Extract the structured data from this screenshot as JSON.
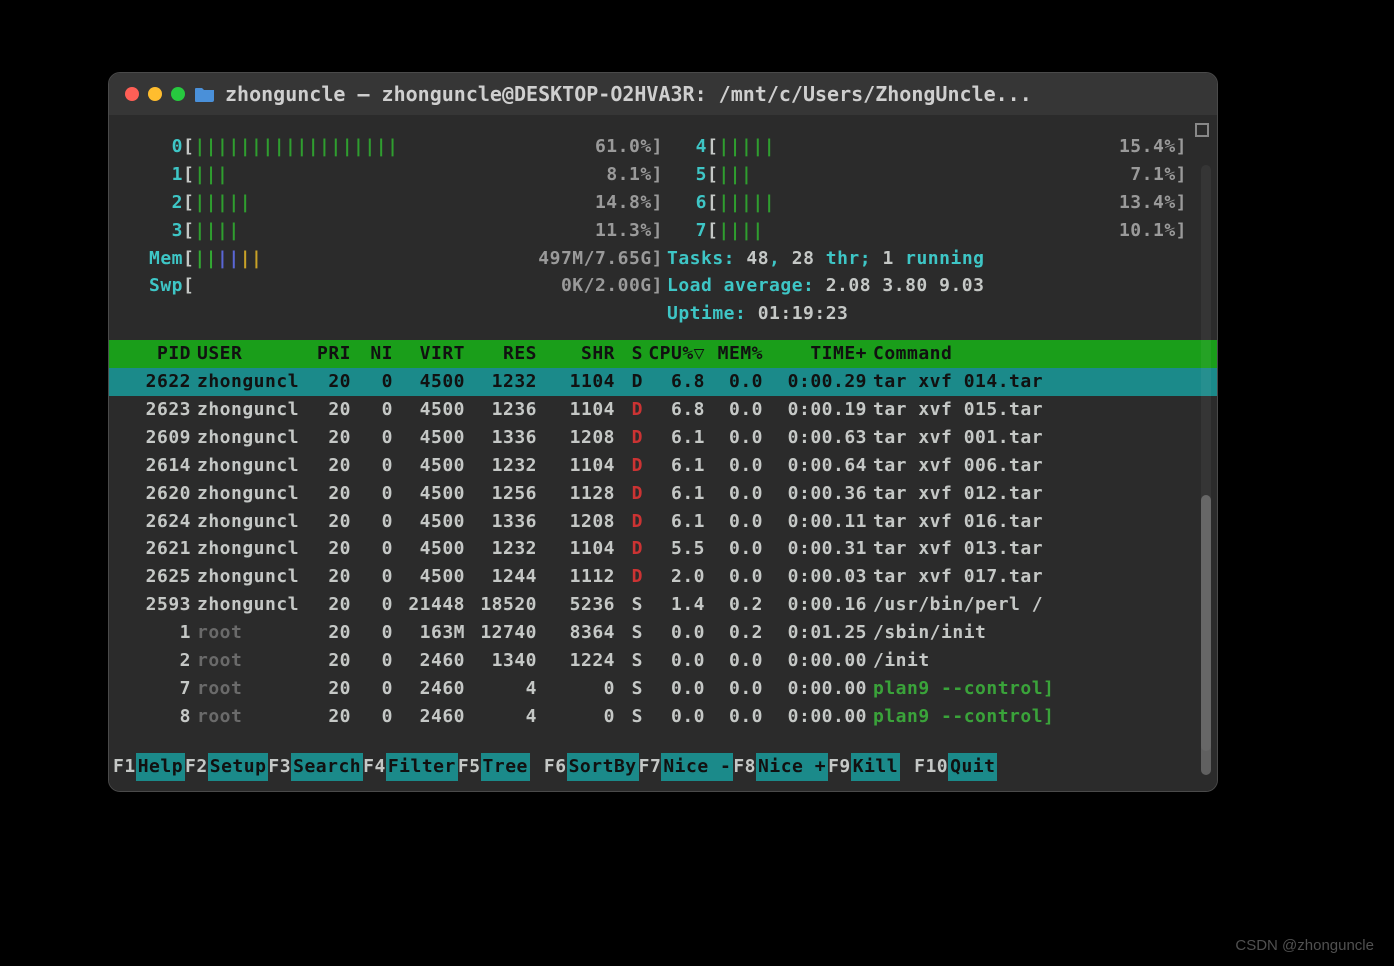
{
  "window": {
    "title": "zhonguncle — zhonguncle@DESKTOP-O2HVA3R: /mnt/c/Users/ZhongUncle..."
  },
  "cpu_meters": [
    {
      "id": "0",
      "bar": "||||||||||||||||||",
      "pct": "61.0%"
    },
    {
      "id": "1",
      "bar": "|||",
      "pct": "8.1%"
    },
    {
      "id": "2",
      "bar": "|||||",
      "pct": "14.8%"
    },
    {
      "id": "3",
      "bar": "||||",
      "pct": "11.3%"
    },
    {
      "id": "4",
      "bar": "|||||",
      "pct": "15.4%"
    },
    {
      "id": "5",
      "bar": "|||",
      "pct": "7.1%"
    },
    {
      "id": "6",
      "bar": "|||||",
      "pct": "13.4%"
    },
    {
      "id": "7",
      "bar": "||||",
      "pct": "10.1%"
    }
  ],
  "mem": {
    "label": "Mem",
    "bar_g": "||",
    "bar_b": "||",
    "bar_y": "||",
    "text": "497M/7.65G"
  },
  "swp": {
    "label": "Swp",
    "bar": "",
    "text": "0K/2.00G"
  },
  "stats": {
    "tasks_label": "Tasks: ",
    "tasks": "48",
    "thr_sep": ", ",
    "thr": "28",
    "thr_label": " thr; ",
    "running": "1",
    "running_label": " running",
    "load_label": "Load average: ",
    "l1": "2.08",
    "l2": "3.80",
    "l3": "9.03",
    "uptime_label": "Uptime: ",
    "uptime": "01:19:23"
  },
  "columns": {
    "pid": "PID",
    "user": "USER",
    "pri": "PRI",
    "ni": "NI",
    "virt": "VIRT",
    "res": "RES",
    "shr": "SHR",
    "s": "S",
    "cpu": "CPU%▽",
    "mem": "MEM%",
    "time": "TIME+",
    "cmd": "Command"
  },
  "processes": [
    {
      "pid": "2622",
      "user": "zhonguncl",
      "pri": "20",
      "ni": "0",
      "virt": "4500",
      "res": "1232",
      "shr": "1104",
      "s": "D",
      "cpu": "6.8",
      "mem": "0.0",
      "time": "0:00.29",
      "cmd": "tar xvf 014.tar",
      "sel": true
    },
    {
      "pid": "2623",
      "user": "zhonguncl",
      "pri": "20",
      "ni": "0",
      "virt": "4500",
      "res": "1236",
      "shr": "1104",
      "s": "D",
      "cpu": "6.8",
      "mem": "0.0",
      "time": "0:00.19",
      "cmd": "tar xvf 015.tar"
    },
    {
      "pid": "2609",
      "user": "zhonguncl",
      "pri": "20",
      "ni": "0",
      "virt": "4500",
      "res": "1336",
      "shr": "1208",
      "s": "D",
      "cpu": "6.1",
      "mem": "0.0",
      "time": "0:00.63",
      "cmd": "tar xvf 001.tar"
    },
    {
      "pid": "2614",
      "user": "zhonguncl",
      "pri": "20",
      "ni": "0",
      "virt": "4500",
      "res": "1232",
      "shr": "1104",
      "s": "D",
      "cpu": "6.1",
      "mem": "0.0",
      "time": "0:00.64",
      "cmd": "tar xvf 006.tar"
    },
    {
      "pid": "2620",
      "user": "zhonguncl",
      "pri": "20",
      "ni": "0",
      "virt": "4500",
      "res": "1256",
      "shr": "1128",
      "s": "D",
      "cpu": "6.1",
      "mem": "0.0",
      "time": "0:00.36",
      "cmd": "tar xvf 012.tar"
    },
    {
      "pid": "2624",
      "user": "zhonguncl",
      "pri": "20",
      "ni": "0",
      "virt": "4500",
      "res": "1336",
      "shr": "1208",
      "s": "D",
      "cpu": "6.1",
      "mem": "0.0",
      "time": "0:00.11",
      "cmd": "tar xvf 016.tar"
    },
    {
      "pid": "2621",
      "user": "zhonguncl",
      "pri": "20",
      "ni": "0",
      "virt": "4500",
      "res": "1232",
      "shr": "1104",
      "s": "D",
      "cpu": "5.5",
      "mem": "0.0",
      "time": "0:00.31",
      "cmd": "tar xvf 013.tar"
    },
    {
      "pid": "2625",
      "user": "zhonguncl",
      "pri": "20",
      "ni": "0",
      "virt": "4500",
      "res": "1244",
      "shr": "1112",
      "s": "D",
      "cpu": "2.0",
      "mem": "0.0",
      "time": "0:00.03",
      "cmd": "tar xvf 017.tar"
    },
    {
      "pid": "2593",
      "user": "zhonguncl",
      "pri": "20",
      "ni": "0",
      "virt": "21448",
      "res": "18520",
      "shr": "5236",
      "s": "S",
      "cpu": "1.4",
      "mem": "0.2",
      "time": "0:00.16",
      "cmd": "/usr/bin/perl /"
    },
    {
      "pid": "1",
      "user": "root",
      "root": true,
      "pri": "20",
      "ni": "0",
      "virt": "163M",
      "res": "12740",
      "shr": "8364",
      "s": "S",
      "cpu": "0.0",
      "mem": "0.2",
      "time": "0:01.25",
      "cmd": "/sbin/init"
    },
    {
      "pid": "2",
      "user": "root",
      "root": true,
      "pri": "20",
      "ni": "0",
      "virt": "2460",
      "res": "1340",
      "shr": "1224",
      "s": "S",
      "cpu": "0.0",
      "mem": "0.0",
      "time": "0:00.00",
      "cmd": "/init"
    },
    {
      "pid": "7",
      "user": "root",
      "root": true,
      "pri": "20",
      "ni": "0",
      "virt": "2460",
      "res": "4",
      "shr": "0",
      "s": "S",
      "cpu": "0.0",
      "mem": "0.0",
      "time": "0:00.00",
      "cmd": "plan9 --control]",
      "green": true
    },
    {
      "pid": "8",
      "user": "root",
      "root": true,
      "pri": "20",
      "ni": "0",
      "virt": "2460",
      "res": "4",
      "shr": "0",
      "s": "S",
      "cpu": "0.0",
      "mem": "0.0",
      "time": "0:00.00",
      "cmd": "plan9 --control]",
      "green": true
    }
  ],
  "footer": [
    {
      "k": "F1",
      "l": "Help"
    },
    {
      "k": "F2",
      "l": "Setup"
    },
    {
      "k": "F3",
      "l": "Search"
    },
    {
      "k": "F4",
      "l": "Filter"
    },
    {
      "k": "F5",
      "l": "Tree"
    },
    {
      "k": "F6",
      "l": "SortBy"
    },
    {
      "k": "F7",
      "l": "Nice -"
    },
    {
      "k": "F8",
      "l": "Nice +"
    },
    {
      "k": "F9",
      "l": "Kill"
    },
    {
      "k": "F10",
      "l": "Quit"
    }
  ],
  "watermark": "CSDN @zhonguncle"
}
